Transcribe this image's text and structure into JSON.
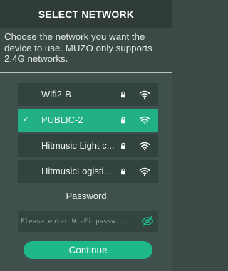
{
  "header": {
    "title": "SELECT NETWORK"
  },
  "description": "Choose the network you want the device to use. MUZO only supports 2.4G networks.",
  "networks": [
    {
      "ssid": "Wifi2-B",
      "selected": false,
      "locked": true,
      "icon": "wifi-icon"
    },
    {
      "ssid": "PUBLIC-2",
      "selected": true,
      "locked": true,
      "icon": "wifi-icon"
    },
    {
      "ssid": "Hitmusic Light c...",
      "selected": false,
      "locked": true,
      "icon": "wifi-icon"
    },
    {
      "ssid": "HitmusicLogisti...",
      "selected": false,
      "locked": true,
      "icon": "wifi-icon"
    }
  ],
  "password": {
    "label": "Password",
    "placeholder": "Please enter Wi-Fi passw...",
    "value": "",
    "toggle_icon": "eye-slash-icon"
  },
  "continue_label": "Continue",
  "colors": {
    "accent": "#1fb88a",
    "background": "#3b4a47",
    "header_bg": "#2f3c39",
    "row_bg": "#33433f"
  }
}
